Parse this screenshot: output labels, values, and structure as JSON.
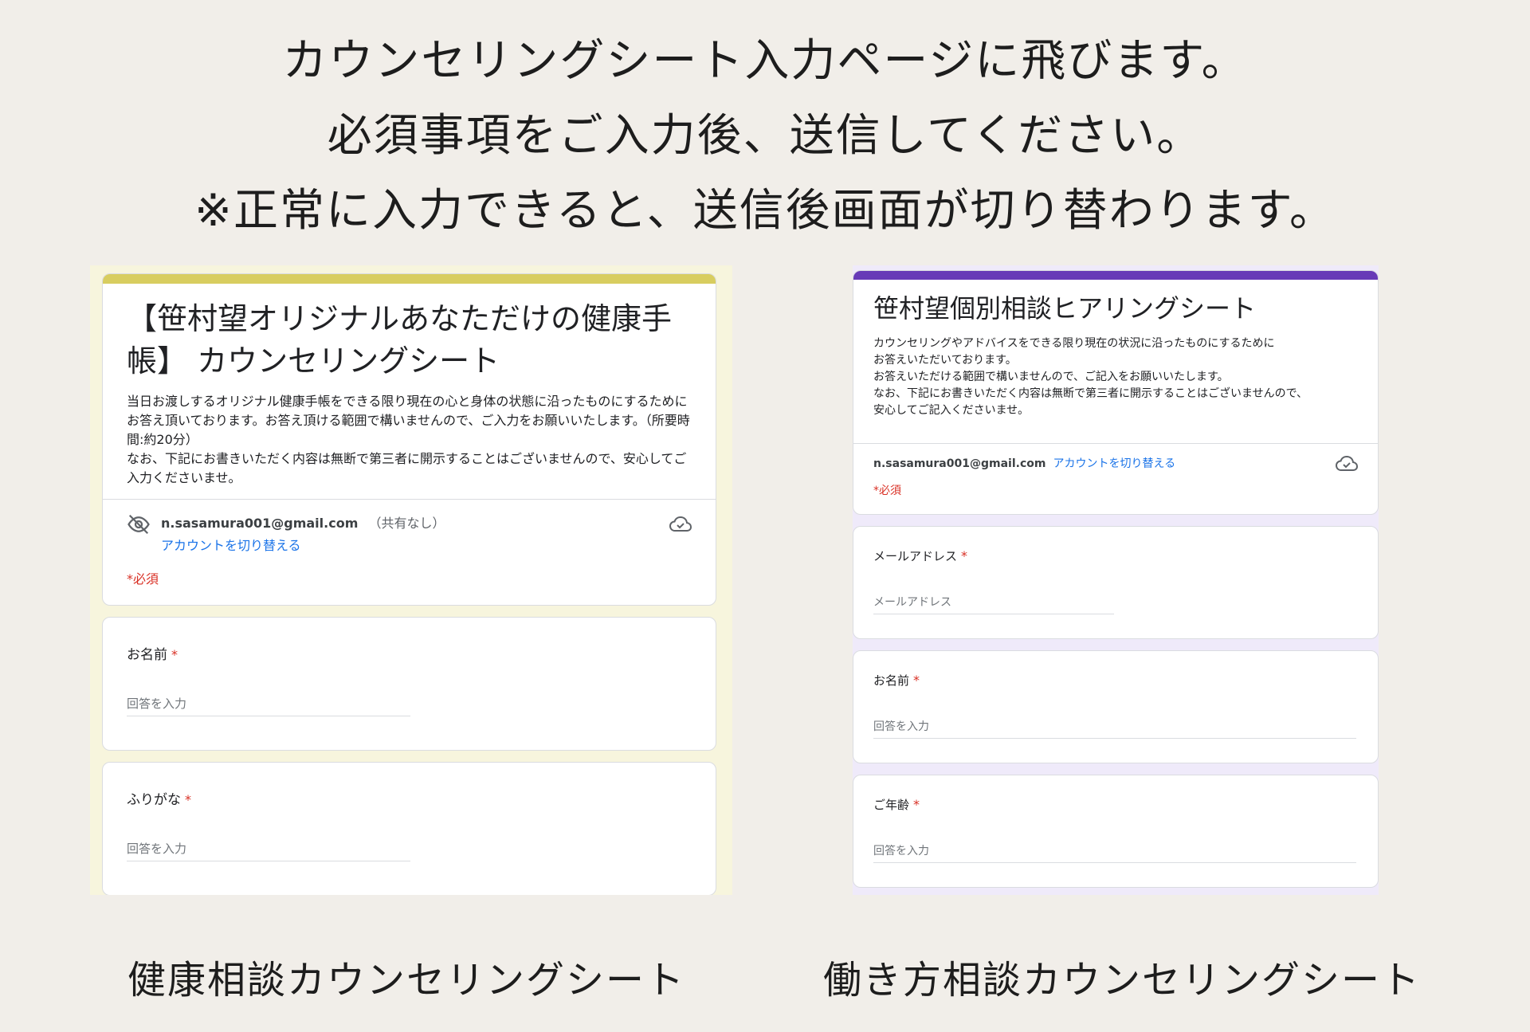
{
  "intro": {
    "line1": "カウンセリングシート入力ページに飛びます。",
    "line2": "必須事項をご入力後、送信してください。",
    "line3": "※正常に入力できると、送信後画面が切り替わります。"
  },
  "left_form": {
    "accent_color": "#d8cd5f",
    "title": "【笹村望オリジナルあなただけの健康手帳】 カウンセリングシート",
    "description": "当日お渡しするオリジナル健康手帳をできる限り現在の心と身体の状態に沿ったものにするためにお答え頂いております。お答え頂ける範囲で構いませんので、ご入力をお願いいたします。（所要時間:約20分）\nなお、下記にお書きいただく内容は無断で第三者に開示することはございませんので、安心してご入力くださいませ。",
    "email": "n.sasamura001@gmail.com",
    "share_status": "（共有なし）",
    "switch_account": "アカウントを切り替える",
    "required_note": "*必須",
    "questions": [
      {
        "label": "お名前",
        "required_mark": "*",
        "placeholder": "回答を入力"
      },
      {
        "label": "ふりがな",
        "required_mark": "*",
        "placeholder": "回答を入力"
      }
    ],
    "caption": "健康相談カウンセリングシート"
  },
  "right_form": {
    "accent_color": "#673ab7",
    "title": "笹村望個別相談ヒアリングシート",
    "description": "カウンセリングやアドバイスをできる限り現在の状況に沿ったものにするために\nお答えいただいております。\nお答えいただける範囲で構いませんので、ご記入をお願いいたします。\nなお、下記にお書きいただく内容は無断で第三者に開示することはございませんので、\n安心してご記入くださいませ。",
    "email": "n.sasamura001@gmail.com",
    "switch_account": "アカウントを切り替える",
    "required_note": "*必須",
    "questions": [
      {
        "label": "メールアドレス",
        "required_mark": "*",
        "placeholder": "メールアドレス"
      },
      {
        "label": "お名前",
        "required_mark": "*",
        "placeholder": "回答を入力"
      },
      {
        "label": "ご年齢",
        "required_mark": "*",
        "placeholder": "回答を入力"
      }
    ],
    "caption": "働き方相談カウンセリングシート"
  }
}
